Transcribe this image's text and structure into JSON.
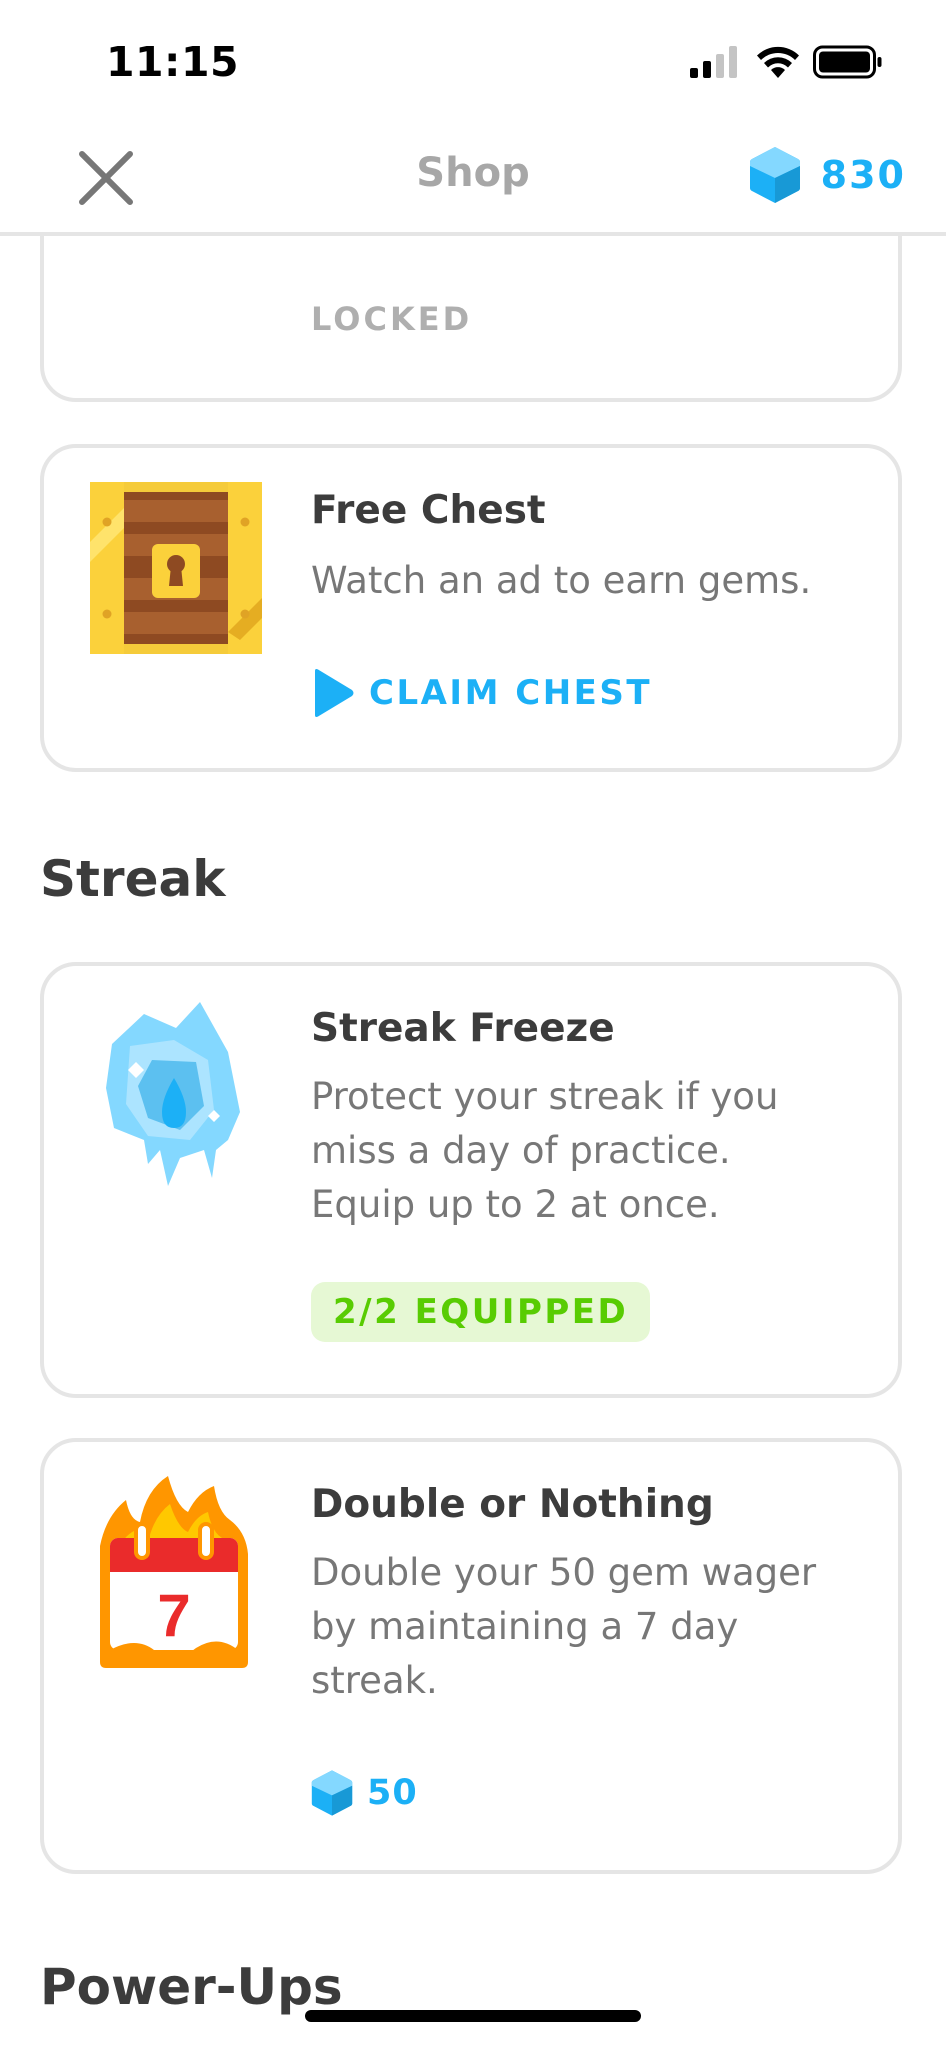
{
  "status_bar": {
    "time": "11:15"
  },
  "header": {
    "title": "Shop",
    "gem_count": "830",
    "close_icon": "close-icon",
    "gem_icon": "gem-icon"
  },
  "items": {
    "locked_card": {
      "label": "LOCKED"
    },
    "free_chest": {
      "title": "Free Chest",
      "description": "Watch an ad to earn gems.",
      "action_label": "CLAIM CHEST",
      "icon": "treasure-chest-icon"
    },
    "streak_freeze": {
      "title": "Streak Freeze",
      "description_lines": [
        "Protect your streak if you",
        "miss a day of practice.",
        "Equip up to 2 at once."
      ],
      "status_label": "2/2 EQUIPPED",
      "icon": "ice-cube-icon"
    },
    "double_or_nothing": {
      "title": "Double or Nothing",
      "description_lines": [
        "Double your 50 gem wager",
        "by maintaining a 7 day",
        "streak."
      ],
      "price": "50",
      "calendar_day": "7",
      "icon": "fire-calendar-icon"
    }
  },
  "sections": {
    "streak": "Streak",
    "power_ups": "Power-Ups"
  },
  "colors": {
    "accent_blue": "#1cb0f6",
    "green": "#58cc02",
    "green_bg": "#e6f8d4",
    "title_text": "#3c3c3c",
    "body_text": "#777777",
    "muted_text": "#afafaf",
    "border": "#e5e5e5"
  }
}
